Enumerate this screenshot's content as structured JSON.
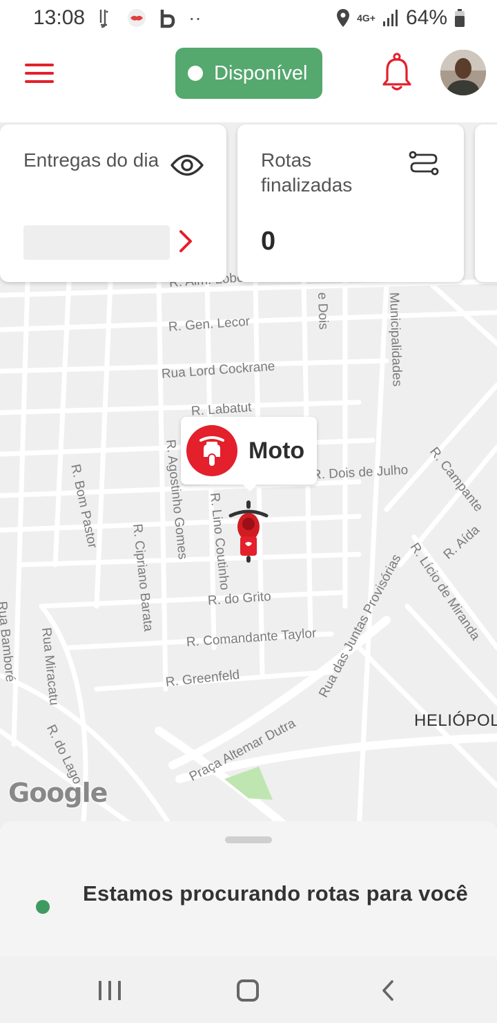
{
  "status_bar": {
    "time": "13:08",
    "app_icons": [
      "lj-app-icon",
      "lips-app-icon",
      "b-app-icon",
      "more-dots-icon"
    ],
    "more_dots": "··",
    "network": "4G+",
    "battery": "64%"
  },
  "header": {
    "availability_label": "Disponível",
    "availability_color": "#55a86e",
    "accent_color": "#e3202c"
  },
  "cards": {
    "deliveries": {
      "title": "Entregas do dia"
    },
    "routes": {
      "title": "Rotas finalizadas",
      "value": "0"
    }
  },
  "map": {
    "streets": [
      "R. Alm. Lobo",
      "R. Gen. Lecor",
      "Rua Lord Cockrane",
      "R. Labatut",
      "R. Agostinho Gomes",
      "R. Bom Pastor",
      "R. Cipriano Barata",
      "R. Lino Coutinho",
      "R. Dois de Julho",
      "R. do Grito",
      "R. Comandante Taylor",
      "R. Greenfeld",
      "Rua Miracatu",
      "R. do Lago",
      "Praça Altemar Dutra",
      "Rua das Juntas Provisórias",
      "R. Lício de Miranda",
      "R. Campante",
      "R. Aída",
      "Municipalidades",
      "e Dois",
      "Rua Bamboré"
    ],
    "district": "HELIÓPOLIS",
    "provider_logo": "Google",
    "marker_label": "Moto"
  },
  "bottom_sheet": {
    "message": "Estamos procurando rotas para você"
  }
}
